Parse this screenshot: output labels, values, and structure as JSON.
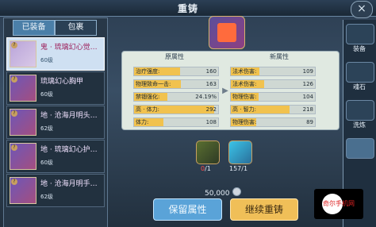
{
  "window": {
    "title": "重铸",
    "close_icon": "x-icon"
  },
  "tabs": [
    {
      "label": "已装备",
      "active": true
    },
    {
      "label": "包裹",
      "active": false
    }
  ],
  "equipment_list": [
    {
      "name": "鬼 · 琉璃幻心觉…",
      "level": "60级",
      "selected": true
    },
    {
      "name": "琉璃幻心胸甲",
      "level": "60级",
      "selected": false
    },
    {
      "name": "地 · 沧海月明头…",
      "level": "62级",
      "selected": false
    },
    {
      "name": "地 · 琉璃幻心护…",
      "level": "60级",
      "selected": false
    },
    {
      "name": "地 · 沧海月明手…",
      "level": "62级",
      "selected": false
    }
  ],
  "attributes": {
    "original_header": "原属性",
    "new_header": "新属性",
    "original": [
      {
        "label": "治疗强度:",
        "value": "160",
        "fill": 0.55
      },
      {
        "label": "物理致命一击:",
        "value": "163",
        "fill": 0.56
      },
      {
        "label": "禁锢强化:",
        "value": "24.19%",
        "fill": 0.4
      },
      {
        "label": "高 · 体力:",
        "value": "292",
        "fill": 0.95
      },
      {
        "label": "体力:",
        "value": "108",
        "fill": 0.35
      }
    ],
    "new": [
      {
        "label": "法术伤害:",
        "value": "109",
        "fill": 0.34
      },
      {
        "label": "法术伤害:",
        "value": "126",
        "fill": 0.4
      },
      {
        "label": "物理伤害:",
        "value": "104",
        "fill": 0.33
      },
      {
        "label": "高 · 智力:",
        "value": "218",
        "fill": 0.7
      },
      {
        "label": "物理伤害:",
        "value": "89",
        "fill": 0.3
      }
    ],
    "arrow_icon": "arrow-right-icon"
  },
  "materials": [
    {
      "icon": "green-token-icon",
      "count_have": "0",
      "count_need": "/1"
    },
    {
      "icon": "blue-crystal-icon",
      "count_have": "157",
      "count_need": "/1"
    }
  ],
  "cost": {
    "amount": "50,000",
    "currency_icon": "silver-coin-icon"
  },
  "buttons": {
    "keep": "保留属性",
    "continue": "继续重铸"
  },
  "side_menu": [
    {
      "label": "装备",
      "selected": false
    },
    {
      "label": "魂石",
      "selected": false
    },
    {
      "label": "洗炼",
      "selected": false
    },
    {
      "label": "",
      "selected": true
    }
  ],
  "watermark": {
    "text": "奇尔手机网"
  }
}
